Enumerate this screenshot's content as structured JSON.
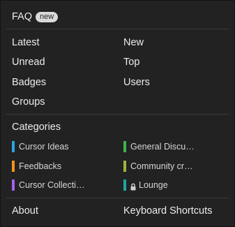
{
  "faq": {
    "label": "FAQ",
    "badge": "new"
  },
  "nav": {
    "latest": "Latest",
    "new": "New",
    "unread": "Unread",
    "top": "Top",
    "badges": "Badges",
    "users": "Users",
    "groups": "Groups"
  },
  "categories": {
    "heading": "Categories",
    "items": [
      {
        "label": "Cursor Ideas",
        "color": "#2ba3e0"
      },
      {
        "label": "General Discu…",
        "color": "#3ab54a"
      },
      {
        "label": "Feedbacks",
        "color": "#f7941d"
      },
      {
        "label": "Community cr…",
        "color": "#a2b33a"
      },
      {
        "label": "Cursor Collecti…",
        "color": "#a461ef"
      },
      {
        "label": "Lounge",
        "color": "#1ea5a0",
        "icon": "lock-icon"
      }
    ]
  },
  "footer": {
    "about": "About",
    "shortcuts": "Keyboard Shortcuts"
  }
}
